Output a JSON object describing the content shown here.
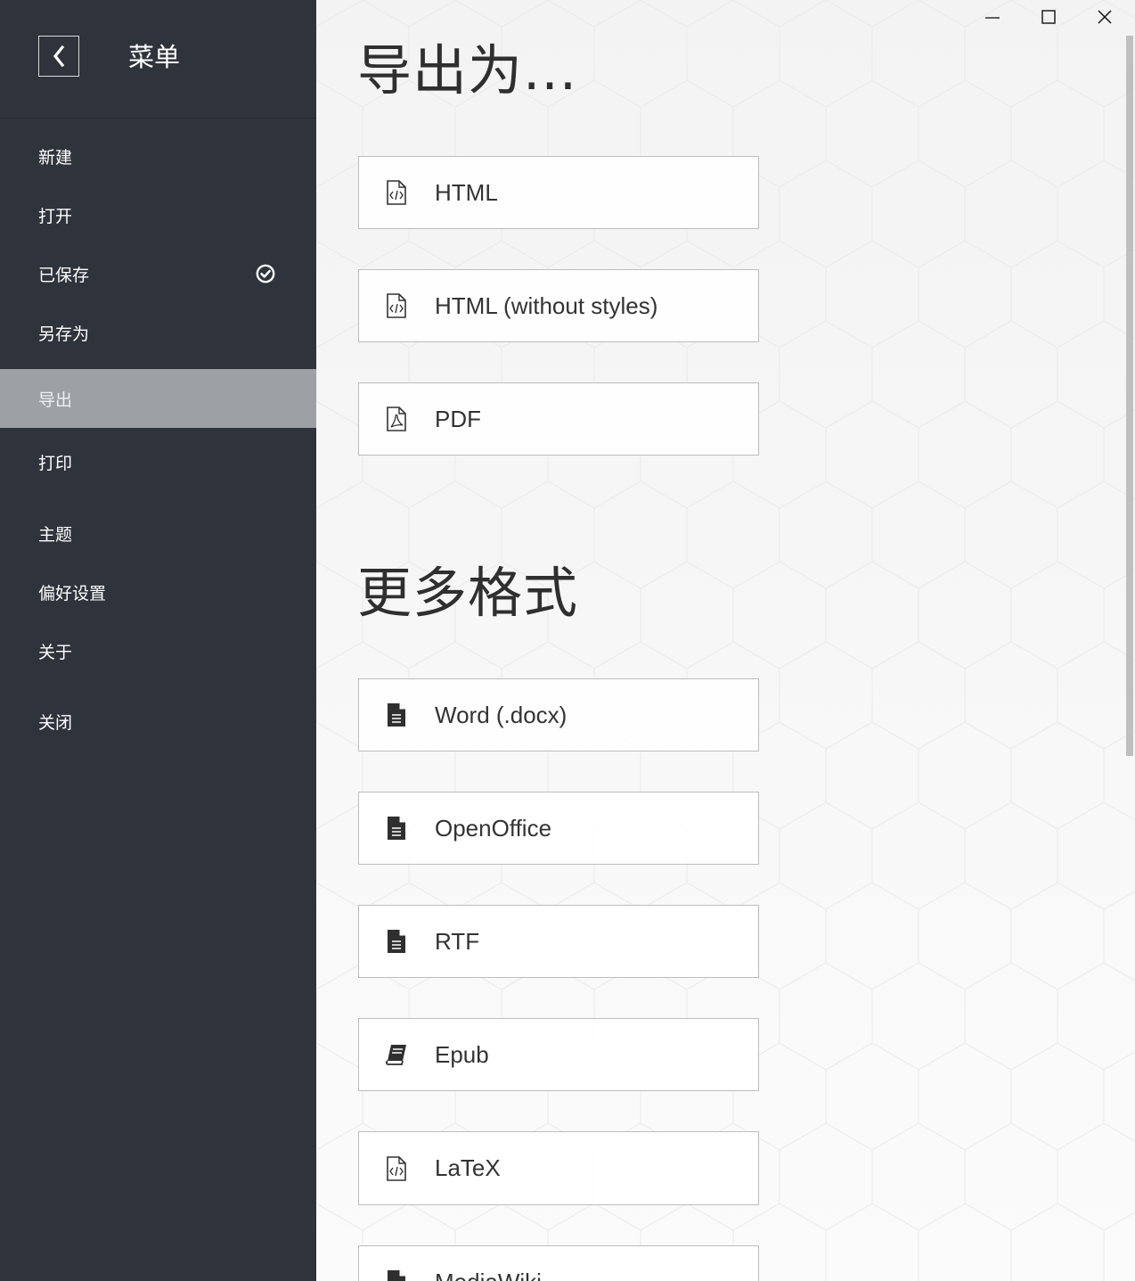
{
  "sidebar": {
    "title": "菜单",
    "back_icon": "chevron-left-icon",
    "items": [
      {
        "id": "new",
        "label": "新建"
      },
      {
        "id": "open",
        "label": "打开"
      },
      {
        "id": "saved",
        "label": "已保存",
        "icon": "check-circle-icon"
      },
      {
        "id": "save-as",
        "label": "另存为"
      },
      {
        "id": "export",
        "label": "导出",
        "active": true
      },
      {
        "id": "print",
        "label": "打印"
      },
      {
        "id": "theme",
        "label": "主题"
      },
      {
        "id": "preferences",
        "label": "偏好设置"
      },
      {
        "id": "about",
        "label": "关于"
      },
      {
        "id": "close",
        "label": "关闭"
      }
    ]
  },
  "main": {
    "export_section": {
      "title": "导出为...",
      "buttons": [
        {
          "label": "HTML",
          "icon": "file-code-icon"
        },
        {
          "label": "HTML (without styles)",
          "icon": "file-code-icon"
        },
        {
          "label": "PDF",
          "icon": "file-pdf-icon"
        }
      ]
    },
    "more_section": {
      "title": "更多格式",
      "buttons": [
        {
          "label": "Word (.docx)",
          "icon": "file-text-icon"
        },
        {
          "label": "OpenOffice",
          "icon": "file-text-icon"
        },
        {
          "label": "RTF",
          "icon": "file-text-icon"
        },
        {
          "label": "Epub",
          "icon": "book-icon"
        },
        {
          "label": "LaTeX",
          "icon": "file-code-icon"
        },
        {
          "label": "MediaWiki",
          "icon": "file-text-icon"
        }
      ]
    }
  },
  "window": {
    "minimize_icon": "minimize-icon",
    "maximize_icon": "maximize-icon",
    "close_icon": "close-icon"
  },
  "colors": {
    "sidebar_bg": "#2f333b",
    "active_item_bg": "#9da1a5",
    "main_bg": "#f6f6f6",
    "button_border": "#bdbdbd",
    "text_dark": "#333333"
  }
}
